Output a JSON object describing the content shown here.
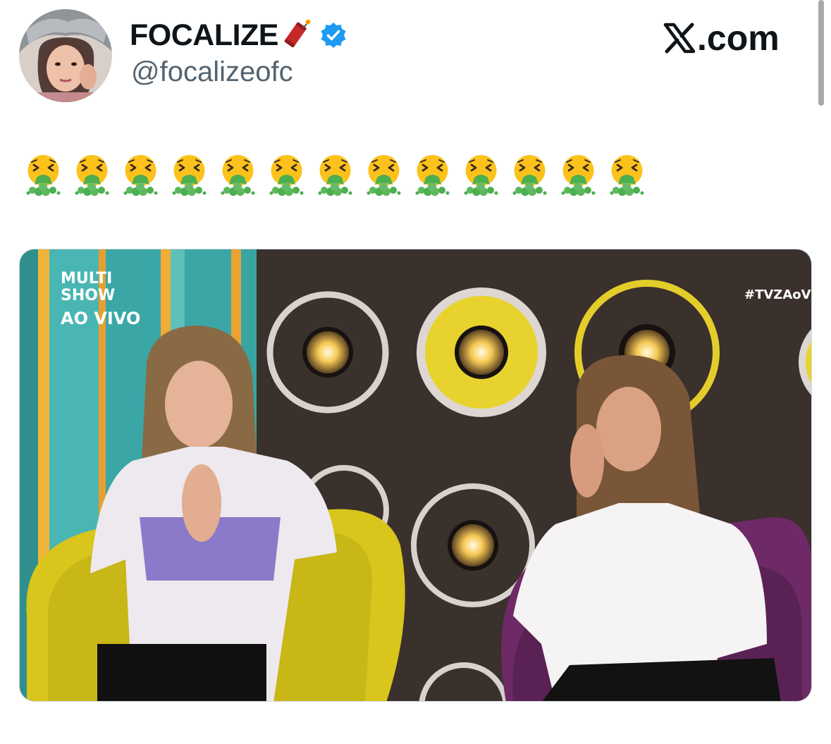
{
  "author": {
    "display_name": "FOCALIZE",
    "name_emoji": "firecracker-icon",
    "verified_icon": "verified-badge-icon",
    "handle": "@focalizeofc",
    "avatar_icon": "avatar"
  },
  "source": {
    "label": ".com",
    "icon": "x-logo-icon"
  },
  "tweet": {
    "emoji_icon": "face-vomiting-icon",
    "emoji_count": 13
  },
  "media": {
    "logo_line1": "MULTI",
    "logo_line2": "SHOW",
    "logo_line3": "AO VIVO",
    "hashtag": "#TVZAoV"
  },
  "colors": {
    "text_primary": "#0f1419",
    "text_secondary": "#536471",
    "verified_blue": "#1d9bf0",
    "set_teal": "#3aa7a6",
    "set_yellow": "#e9d51f",
    "wall_dark": "#3a302c"
  }
}
